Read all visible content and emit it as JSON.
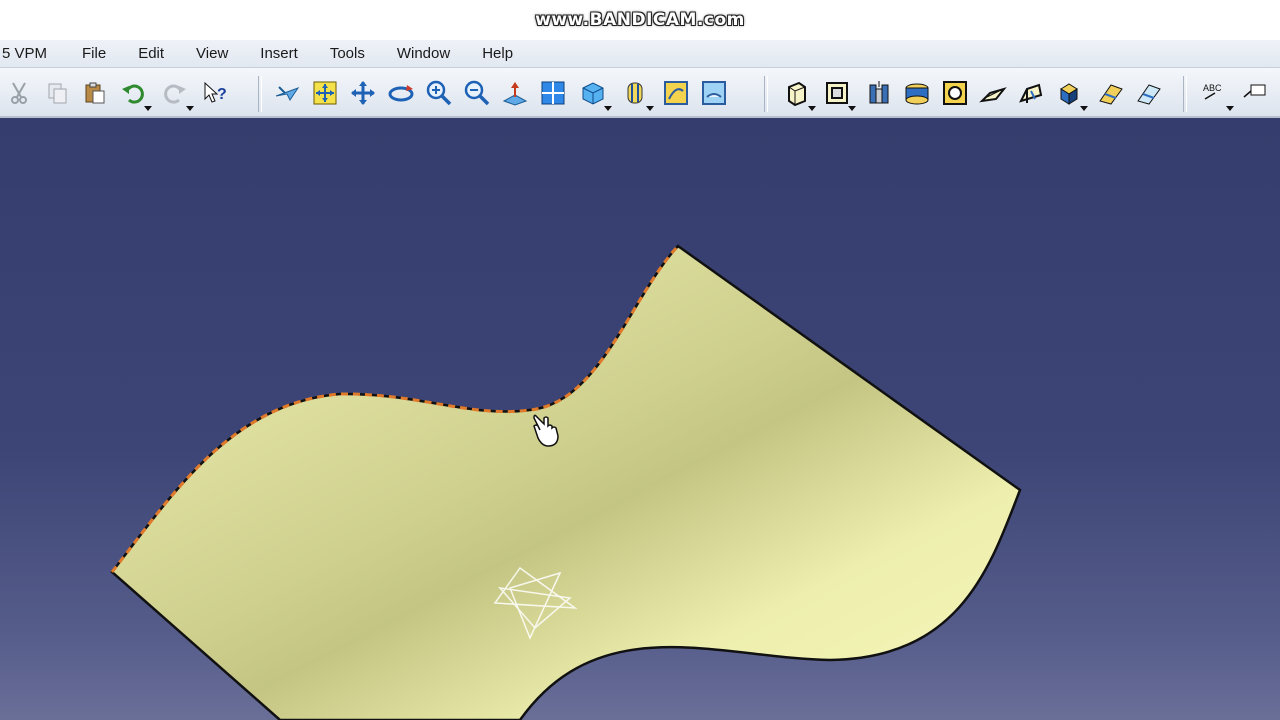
{
  "watermark": "www.BANDICAM.com",
  "menubar": {
    "app_title": "5 VPM",
    "items": [
      "File",
      "Edit",
      "View",
      "Insert",
      "Tools",
      "Window",
      "Help"
    ]
  },
  "toolbar": {
    "left_group": [
      "cut-icon",
      "copy-icon",
      "paste-icon",
      "undo-icon",
      "redo-icon",
      "whats-this-icon"
    ],
    "view_group": [
      "fly-mode-icon",
      "fit-all-icon",
      "pan-icon",
      "rotate-icon",
      "zoom-in-icon",
      "zoom-out-icon",
      "normal-view-icon",
      "multi-view-icon",
      "iso-view-icon",
      "render-style-icon",
      "hide-show-icon",
      "swap-visible-icon"
    ],
    "right_group": [
      "pad-icon",
      "pocket-icon",
      "shaft-icon",
      "groove-icon",
      "hole-icon",
      "rib-icon",
      "slot-icon",
      "solid-combine-icon",
      "multi-section-solid-icon",
      "removed-multi-section-icon"
    ],
    "annotation_group": [
      "text-annotation-icon",
      "flag-note-icon"
    ]
  },
  "viewport": {
    "background": "#3b4476",
    "surface_color": "#eef0a6",
    "highlight_edge_color": "#e07a2a"
  }
}
